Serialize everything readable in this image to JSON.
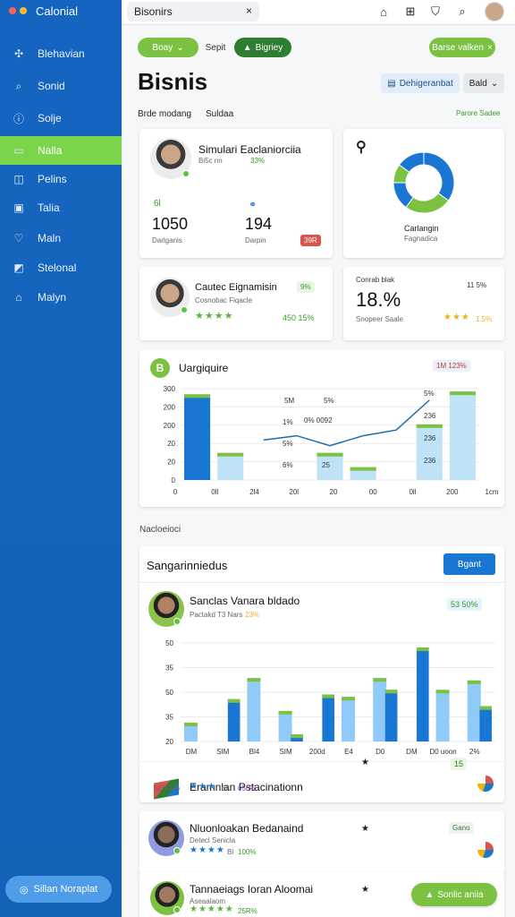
{
  "app": {
    "title": "Calonial"
  },
  "colors": {
    "sidebar": "#1565c0",
    "accent_green": "#7cc242",
    "dark_green": "#2e7d32",
    "blue": "#1976d2",
    "light_blue": "#90caf9"
  },
  "sidebar": {
    "items": [
      {
        "label": "Blehavian",
        "icon": "puzzle-icon"
      },
      {
        "label": "Sonid",
        "icon": "search-icon"
      },
      {
        "label": "Solje",
        "icon": "info-icon"
      },
      {
        "label": "Nalla",
        "icon": "folder-icon",
        "active": true
      },
      {
        "label": "Pelins",
        "icon": "table-icon"
      },
      {
        "label": "Talia",
        "icon": "doc-icon"
      },
      {
        "label": "Maln",
        "icon": "heart-icon"
      },
      {
        "label": "Stelonal",
        "icon": "chart-icon"
      },
      {
        "label": "Malyn",
        "icon": "home-icon"
      }
    ],
    "cta": "Sillan Noraplat"
  },
  "topbar": {
    "tab_label": "Bisonirs",
    "tab_close": "×"
  },
  "toolbar": {
    "pill1": "Boay",
    "pill2": "Sepit",
    "pill3": "Bigriey",
    "pill4": "Barse valken",
    "btn_filter": "Dehigeranbat",
    "btn_edit": "Bald"
  },
  "page": {
    "title": "Bisnis",
    "sub_left": "Brde modang",
    "sub_mid": "Suldaa",
    "sub_right": "Parore Sadee"
  },
  "profile_card": {
    "name": "Simulari Eaclaniorciia",
    "meta": "Bi5c nn",
    "meta_pct": "33%",
    "stat1_label": "Darlganis",
    "stat1_value": "1050",
    "stat1_icon": "6l",
    "stat2_label": "Darpin",
    "stat2_value": "194",
    "stat2_badge": "39R"
  },
  "donut_card": {
    "label": "Carlangin",
    "sublabel": "Fagnadica",
    "chart_data": {
      "type": "pie",
      "values": [
        35,
        25,
        15,
        10,
        15
      ],
      "colors": [
        "#1976d2",
        "#7cc242",
        "#1976d2",
        "#7cc242",
        "#1976d2"
      ]
    }
  },
  "person2_card": {
    "name": "Cautec Eignamisin",
    "meta": "Cosnobac Fiqacle",
    "badge": "9%",
    "value": "450 15%"
  },
  "stat_card": {
    "label": "Conrab blak",
    "tag": "11 5%",
    "value": "18.%",
    "foot": "Snopeer Saale",
    "foot_pct": "1.5%"
  },
  "chart1": {
    "title": "Uargiquire",
    "badge": "1M 123%",
    "y_ticks": [
      "300",
      "200",
      "200",
      "20",
      "20",
      "0"
    ],
    "x_ticks": [
      "0",
      "0ll",
      "2l4",
      "20l",
      "20",
      "00",
      "0ll",
      "200",
      "1cm"
    ],
    "labels_right": [
      "5%",
      "236",
      "236",
      "236"
    ],
    "labels_mid": [
      "5M",
      "5%",
      "1%",
      "0% 0092",
      "5%",
      "6%",
      "25"
    ],
    "chart_data": {
      "type": "bar",
      "values": [
        300,
        95,
        0,
        0,
        95,
        45,
        0,
        195,
        310
      ],
      "line": [
        0,
        0,
        140,
        155,
        120,
        155,
        175,
        280
      ]
    }
  },
  "section_label": "Nacloeioci",
  "panel": {
    "title": "Sangarinniedus",
    "button": "Bgant",
    "person": {
      "name": "Sanclas Vanara bldado",
      "meta": "Pactakd T3 Nars",
      "meta_pct": "23%",
      "badge": "53 50%"
    },
    "chart_data": {
      "type": "bar",
      "y_ticks": [
        "50",
        "35",
        "50",
        "35",
        "20"
      ],
      "x_ticks": [
        "DM",
        "SIM",
        "Bl4",
        "SIM",
        "200d",
        "E4",
        "D0",
        "DM",
        "D0 uoon",
        "2%"
      ],
      "series": [
        {
          "name": "dark",
          "values": [
            0,
            18,
            0,
            3,
            20,
            0,
            22,
            40,
            0,
            15
          ]
        },
        {
          "name": "light",
          "values": [
            8,
            0,
            27,
            13,
            0,
            19,
            27,
            0,
            22,
            26
          ]
        }
      ]
    },
    "row1": {
      "name": "Eramnlan Pstacinationn",
      "meta": "Scholab",
      "rating": "6l",
      "pct": "050%",
      "badge": "15"
    },
    "row2": {
      "name": "Nluonloakan Bedanaind",
      "meta": "Detecl Senicla",
      "rating": "Bl",
      "pct": "100%",
      "badge": "Gano"
    },
    "row3": {
      "name": "Tannaeiags Ioran Aloomai",
      "meta": "Aseaalaom",
      "rating": "",
      "pct": "25R%",
      "badge": "Sonlic aniia"
    }
  }
}
